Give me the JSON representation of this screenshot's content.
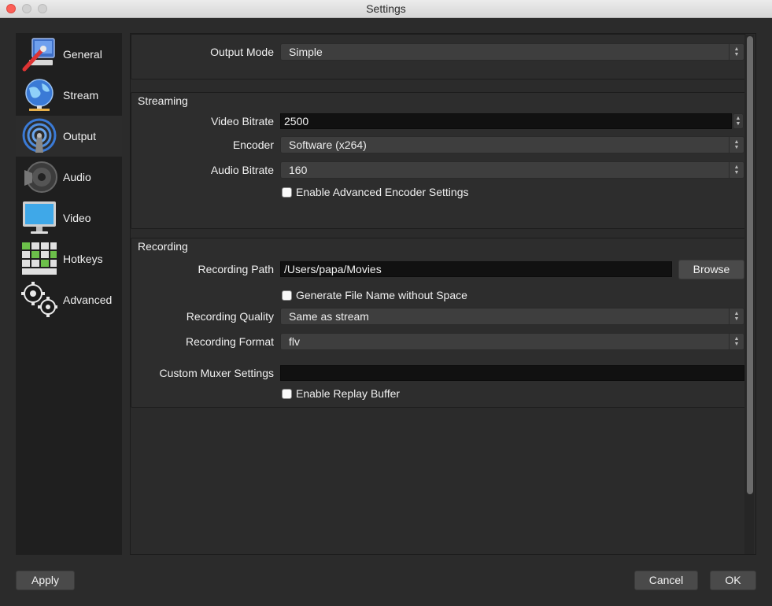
{
  "window": {
    "title": "Settings"
  },
  "sidebar": {
    "items": [
      {
        "label": "General",
        "icon": "general-icon"
      },
      {
        "label": "Stream",
        "icon": "stream-globe-icon"
      },
      {
        "label": "Output",
        "icon": "output-broadcast-icon"
      },
      {
        "label": "Audio",
        "icon": "audio-speaker-icon"
      },
      {
        "label": "Video",
        "icon": "video-monitor-icon"
      },
      {
        "label": "Hotkeys",
        "icon": "hotkeys-keyboard-icon"
      },
      {
        "label": "Advanced",
        "icon": "advanced-gears-icon"
      }
    ],
    "active": "Output"
  },
  "output": {
    "mode_label": "Output Mode",
    "mode_value": "Simple"
  },
  "streaming": {
    "title": "Streaming",
    "video_bitrate_label": "Video Bitrate",
    "video_bitrate_value": "2500",
    "encoder_label": "Encoder",
    "encoder_value": "Software (x264)",
    "audio_bitrate_label": "Audio Bitrate",
    "audio_bitrate_value": "160",
    "advanced_encoder_label": "Enable Advanced Encoder Settings",
    "advanced_encoder_checked": false
  },
  "recording": {
    "title": "Recording",
    "path_label": "Recording Path",
    "path_value": "/Users/papa/Movies",
    "browse_label": "Browse",
    "filename_nospace_label": "Generate File Name without Space",
    "quality_label": "Recording Quality",
    "quality_value": "Same as stream",
    "format_label": "Recording Format",
    "format_value": "flv",
    "muxer_label": "Custom Muxer Settings",
    "muxer_value": "",
    "replay_buffer_label": "Enable Replay Buffer"
  },
  "footer": {
    "apply_label": "Apply",
    "cancel_label": "Cancel",
    "ok_label": "OK"
  },
  "colors": {
    "background": "#2b2b2b",
    "sidebar": "#1f1f1f",
    "close_button": "#fc5f57"
  }
}
